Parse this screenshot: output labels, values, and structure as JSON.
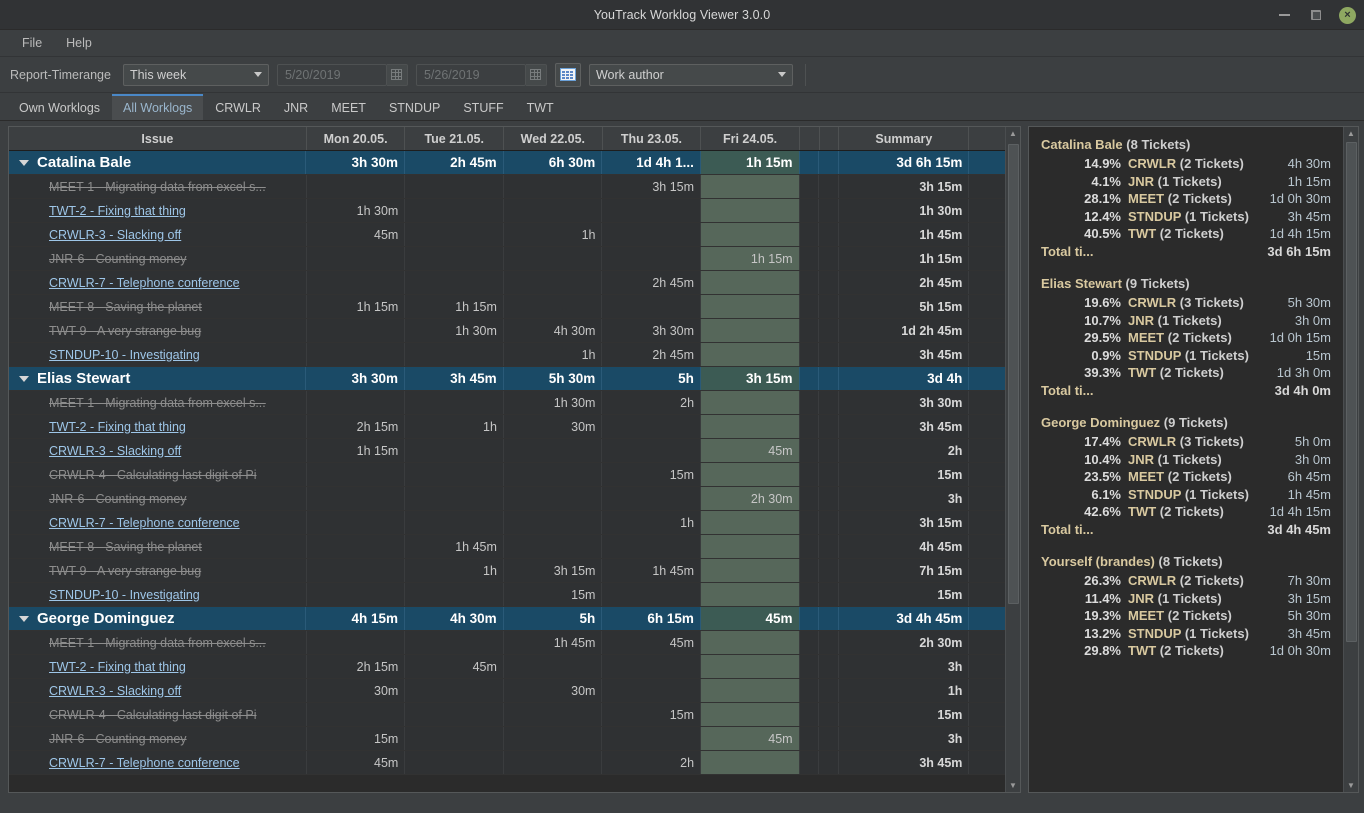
{
  "window": {
    "title": "YouTrack Worklog Viewer 3.0.0",
    "controls": {
      "minimize": "minimize-icon",
      "maximize": "maximize-icon",
      "close": "×"
    }
  },
  "menubar": {
    "items": [
      {
        "label": "File"
      },
      {
        "label": "Help"
      }
    ]
  },
  "toolbar": {
    "timerange_label": "Report-Timerange",
    "timerange_value": "This week",
    "date_from": "5/20/2019",
    "date_to": "5/26/2019",
    "export_icon": "spreadsheet-icon",
    "grouping_value": "Work author"
  },
  "tabs": [
    {
      "label": "Own Worklogs",
      "active": false
    },
    {
      "label": "All Worklogs",
      "active": true
    },
    {
      "label": "CRWLR",
      "active": false
    },
    {
      "label": "JNR",
      "active": false
    },
    {
      "label": "MEET",
      "active": false
    },
    {
      "label": "STNDUP",
      "active": false
    },
    {
      "label": "STUFF",
      "active": false
    },
    {
      "label": "TWT",
      "active": false
    }
  ],
  "table": {
    "columns": [
      "Issue",
      "Mon 20.05.",
      "Tue 21.05.",
      "Wed 22.05.",
      "Thu 23.05.",
      "Fri 24.05.",
      "",
      "",
      "Summary",
      ""
    ],
    "today_column_index": 5,
    "rows": [
      {
        "type": "group",
        "issue": "Catalina Bale",
        "cells": [
          "3h 30m",
          "2h 45m",
          "6h 30m",
          "1d 4h 1...",
          "1h 15m",
          "",
          ""
        ],
        "summary": "3d 6h 15m"
      },
      {
        "type": "issue",
        "state": "done",
        "issue": "MEET-1 - Migrating data from excel s...",
        "cells": [
          "",
          "",
          "",
          "3h 15m",
          "",
          "",
          ""
        ],
        "summary": "3h 15m"
      },
      {
        "type": "issue",
        "state": "open",
        "issue": "TWT-2 - Fixing that thing",
        "cells": [
          "1h 30m",
          "",
          "",
          "",
          "",
          "",
          ""
        ],
        "summary": "1h 30m"
      },
      {
        "type": "issue",
        "state": "open",
        "issue": "CRWLR-3 - Slacking off",
        "cells": [
          "45m",
          "",
          "1h",
          "",
          "",
          "",
          ""
        ],
        "summary": "1h 45m"
      },
      {
        "type": "issue",
        "state": "done",
        "issue": "JNR-6 - Counting money",
        "cells": [
          "",
          "",
          "",
          "",
          "1h 15m",
          "",
          ""
        ],
        "summary": "1h 15m"
      },
      {
        "type": "issue",
        "state": "open",
        "issue": "CRWLR-7 - Telephone conference",
        "cells": [
          "",
          "",
          "",
          "2h 45m",
          "",
          "",
          ""
        ],
        "summary": "2h 45m"
      },
      {
        "type": "issue",
        "state": "done",
        "issue": "MEET-8 - Saving the planet",
        "cells": [
          "1h 15m",
          "1h 15m",
          "",
          "",
          "",
          "",
          ""
        ],
        "summary": "5h 15m"
      },
      {
        "type": "issue",
        "state": "done",
        "issue": "TWT-9 - A very strange bug",
        "cells": [
          "",
          "1h 30m",
          "4h 30m",
          "3h 30m",
          "",
          "",
          ""
        ],
        "summary": "1d 2h 45m"
      },
      {
        "type": "issue",
        "state": "open",
        "issue": "STNDUP-10 - Investigating",
        "cells": [
          "",
          "",
          "1h",
          "2h 45m",
          "",
          "",
          ""
        ],
        "summary": "3h 45m"
      },
      {
        "type": "group",
        "issue": "Elias Stewart",
        "cells": [
          "3h 30m",
          "3h 45m",
          "5h 30m",
          "5h",
          "3h 15m",
          "",
          ""
        ],
        "summary": "3d 4h"
      },
      {
        "type": "issue",
        "state": "done",
        "issue": "MEET-1 - Migrating data from excel s...",
        "cells": [
          "",
          "",
          "1h 30m",
          "2h",
          "",
          "",
          ""
        ],
        "summary": "3h 30m"
      },
      {
        "type": "issue",
        "state": "open",
        "issue": "TWT-2 - Fixing that thing",
        "cells": [
          "2h 15m",
          "1h",
          "30m",
          "",
          "",
          "",
          ""
        ],
        "summary": "3h 45m"
      },
      {
        "type": "issue",
        "state": "open",
        "issue": "CRWLR-3 - Slacking off",
        "cells": [
          "1h 15m",
          "",
          "",
          "",
          "45m",
          "",
          ""
        ],
        "summary": "2h"
      },
      {
        "type": "issue",
        "state": "done",
        "issue": "CRWLR-4 - Calculating last digit of Pi",
        "cells": [
          "",
          "",
          "",
          "15m",
          "",
          "",
          ""
        ],
        "summary": "15m"
      },
      {
        "type": "issue",
        "state": "done",
        "issue": "JNR-6 - Counting money",
        "cells": [
          "",
          "",
          "",
          "",
          "2h 30m",
          "",
          ""
        ],
        "summary": "3h"
      },
      {
        "type": "issue",
        "state": "open",
        "issue": "CRWLR-7 - Telephone conference",
        "cells": [
          "",
          "",
          "",
          "1h",
          "",
          "",
          ""
        ],
        "summary": "3h 15m"
      },
      {
        "type": "issue",
        "state": "done",
        "issue": "MEET-8 - Saving the planet",
        "cells": [
          "",
          "1h 45m",
          "",
          "",
          "",
          "",
          ""
        ],
        "summary": "4h 45m"
      },
      {
        "type": "issue",
        "state": "done",
        "issue": "TWT-9 - A very strange bug",
        "cells": [
          "",
          "1h",
          "3h 15m",
          "1h 45m",
          "",
          "",
          ""
        ],
        "summary": "7h 15m"
      },
      {
        "type": "issue",
        "state": "open",
        "issue": "STNDUP-10 - Investigating",
        "cells": [
          "",
          "",
          "15m",
          "",
          "",
          "",
          ""
        ],
        "summary": "15m"
      },
      {
        "type": "group",
        "issue": "George Dominguez",
        "cells": [
          "4h 15m",
          "4h 30m",
          "5h",
          "6h 15m",
          "45m",
          "",
          ""
        ],
        "summary": "3d 4h 45m"
      },
      {
        "type": "issue",
        "state": "done",
        "issue": "MEET-1 - Migrating data from excel s...",
        "cells": [
          "",
          "",
          "1h 45m",
          "45m",
          "",
          "",
          ""
        ],
        "summary": "2h 30m"
      },
      {
        "type": "issue",
        "state": "open",
        "issue": "TWT-2 - Fixing that thing",
        "cells": [
          "2h 15m",
          "45m",
          "",
          "",
          "",
          "",
          ""
        ],
        "summary": "3h"
      },
      {
        "type": "issue",
        "state": "open",
        "issue": "CRWLR-3 - Slacking off",
        "cells": [
          "30m",
          "",
          "30m",
          "",
          "",
          "",
          ""
        ],
        "summary": "1h"
      },
      {
        "type": "issue",
        "state": "done",
        "issue": "CRWLR-4 - Calculating last digit of Pi",
        "cells": [
          "",
          "",
          "",
          "15m",
          "",
          "",
          ""
        ],
        "summary": "15m"
      },
      {
        "type": "issue",
        "state": "done",
        "issue": "JNR-6 - Counting money",
        "cells": [
          "15m",
          "",
          "",
          "",
          "45m",
          "",
          ""
        ],
        "summary": "3h"
      },
      {
        "type": "issue",
        "state": "open",
        "issue": "CRWLR-7 - Telephone conference",
        "cells": [
          "45m",
          "",
          "",
          "2h",
          "",
          "",
          ""
        ],
        "summary": "3h 45m"
      }
    ]
  },
  "summary_panel": {
    "blocks": [
      {
        "name": "Catalina Bale",
        "tickets": "(8 Tickets)",
        "lines": [
          {
            "pct": "14.9%",
            "project": "CRWLR",
            "count": "(2 Tickets)",
            "duration": "4h 30m"
          },
          {
            "pct": "4.1%",
            "project": "JNR",
            "count": "(1 Tickets)",
            "duration": "1h 15m"
          },
          {
            "pct": "28.1%",
            "project": "MEET",
            "count": "(2 Tickets)",
            "duration": "1d 0h 30m"
          },
          {
            "pct": "12.4%",
            "project": "STNDUP",
            "count": "(1 Tickets)",
            "duration": "3h 45m"
          },
          {
            "pct": "40.5%",
            "project": "TWT",
            "count": "(2 Tickets)",
            "duration": "1d 4h 15m"
          }
        ],
        "total_label": "Total ti...",
        "total_value": "3d 6h 15m"
      },
      {
        "name": "Elias Stewart",
        "tickets": "(9 Tickets)",
        "lines": [
          {
            "pct": "19.6%",
            "project": "CRWLR",
            "count": "(3 Tickets)",
            "duration": "5h 30m"
          },
          {
            "pct": "10.7%",
            "project": "JNR",
            "count": "(1 Tickets)",
            "duration": "3h 0m"
          },
          {
            "pct": "29.5%",
            "project": "MEET",
            "count": "(2 Tickets)",
            "duration": "1d 0h 15m"
          },
          {
            "pct": "0.9%",
            "project": "STNDUP",
            "count": "(1 Tickets)",
            "duration": "15m"
          },
          {
            "pct": "39.3%",
            "project": "TWT",
            "count": "(2 Tickets)",
            "duration": "1d 3h 0m"
          }
        ],
        "total_label": "Total ti...",
        "total_value": "3d 4h 0m"
      },
      {
        "name": "George Dominguez",
        "tickets": "(9 Tickets)",
        "lines": [
          {
            "pct": "17.4%",
            "project": "CRWLR",
            "count": "(3 Tickets)",
            "duration": "5h 0m"
          },
          {
            "pct": "10.4%",
            "project": "JNR",
            "count": "(1 Tickets)",
            "duration": "3h 0m"
          },
          {
            "pct": "23.5%",
            "project": "MEET",
            "count": "(2 Tickets)",
            "duration": "6h 45m"
          },
          {
            "pct": "6.1%",
            "project": "STNDUP",
            "count": "(1 Tickets)",
            "duration": "1h 45m"
          },
          {
            "pct": "42.6%",
            "project": "TWT",
            "count": "(2 Tickets)",
            "duration": "1d 4h 15m"
          }
        ],
        "total_label": "Total ti...",
        "total_value": "3d 4h 45m"
      },
      {
        "name": "Yourself (brandes)",
        "tickets": "(8 Tickets)",
        "lines": [
          {
            "pct": "26.3%",
            "project": "CRWLR",
            "count": "(2 Tickets)",
            "duration": "7h 30m"
          },
          {
            "pct": "11.4%",
            "project": "JNR",
            "count": "(1 Tickets)",
            "duration": "3h 15m"
          },
          {
            "pct": "19.3%",
            "project": "MEET",
            "count": "(2 Tickets)",
            "duration": "5h 30m"
          },
          {
            "pct": "13.2%",
            "project": "STNDUP",
            "count": "(1 Tickets)",
            "duration": "3h 45m"
          },
          {
            "pct": "29.8%",
            "project": "TWT",
            "count": "(2 Tickets)",
            "duration": "1d 0h 30m"
          }
        ],
        "total_label": "",
        "total_value": ""
      }
    ]
  },
  "colors": {
    "accent_blue": "#4a88c7",
    "group_row": "#1a4a66",
    "today_column": "#56675a",
    "link": "#9ec6e8",
    "project_name": "#d9c9a0",
    "close_button": "#8ea861"
  }
}
